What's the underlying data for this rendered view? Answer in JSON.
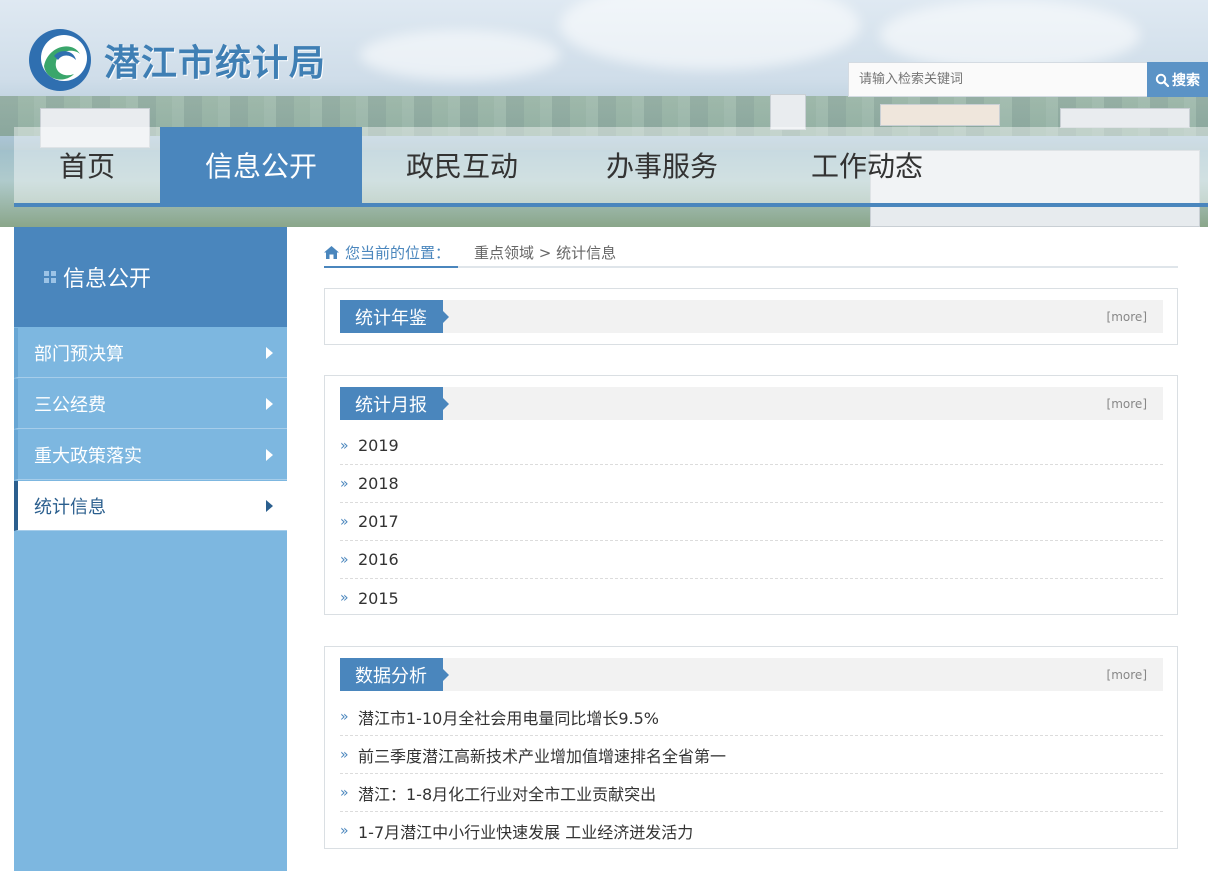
{
  "site": {
    "title": "潜江市统计局"
  },
  "search": {
    "placeholder": "请输入检索关键词",
    "button": "搜索"
  },
  "nav": {
    "items": [
      {
        "label": "首页",
        "active": false
      },
      {
        "label": "信息公开",
        "active": true
      },
      {
        "label": "政民互动",
        "active": false
      },
      {
        "label": "办事服务",
        "active": false
      },
      {
        "label": "工作动态",
        "active": false
      }
    ]
  },
  "sidebar": {
    "title": "信息公开",
    "items": [
      {
        "label": "部门预决算",
        "active": false
      },
      {
        "label": "三公经费",
        "active": false
      },
      {
        "label": "重大政策落实",
        "active": false
      },
      {
        "label": "统计信息",
        "active": true
      }
    ]
  },
  "breadcrumb": {
    "prefix": "您当前的位置：",
    "path": "重点领域 > 统计信息"
  },
  "panels": {
    "yearbook": {
      "title": "统计年鉴",
      "more": "[more]"
    },
    "monthly": {
      "title": "统计月报",
      "more": "[more]",
      "items": [
        "2019",
        "2018",
        "2017",
        "2016",
        "2015"
      ]
    },
    "analysis": {
      "title": "数据分析",
      "more": "[more]",
      "items": [
        "潜江市1-10月全社会用电量同比增长9.5%",
        "前三季度潜江高新技术产业增加值增速排名全省第一",
        "潜江：1-8月化工行业对全市工业贡献突出",
        "1-7月潜江中小行业快速发展 工业经济迸发活力"
      ]
    }
  },
  "colors": {
    "primary": "#4a86bd",
    "sidebar": "#7db7e0",
    "title": "#3f7fb4"
  }
}
